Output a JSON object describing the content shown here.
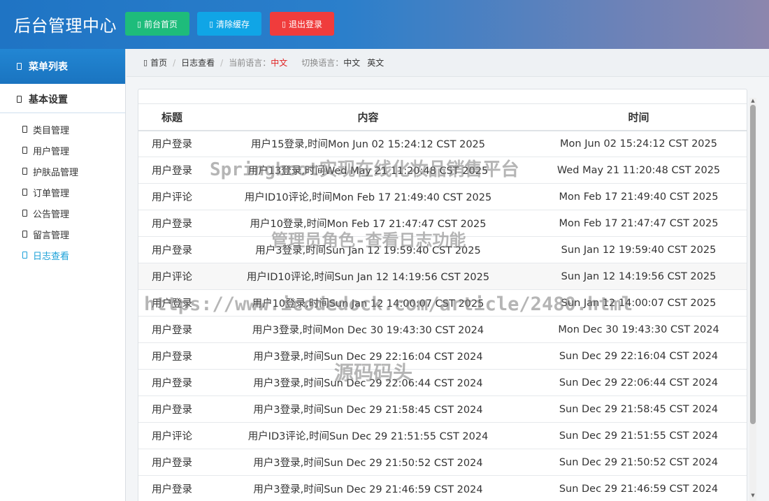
{
  "header": {
    "title": "后台管理中心",
    "buttons": [
      {
        "label": "前台首页",
        "color": "#1ebc7b"
      },
      {
        "label": "清除缓存",
        "color": "#10a5e6"
      },
      {
        "label": "退出登录",
        "color": "#f03c3c"
      }
    ]
  },
  "sidebar": {
    "menu_title": "菜单列表",
    "group_title": "基本设置",
    "items": [
      {
        "label": "类目管理"
      },
      {
        "label": "用户管理"
      },
      {
        "label": "护肤品管理"
      },
      {
        "label": "订单管理"
      },
      {
        "label": "公告管理"
      },
      {
        "label": "留言管理"
      },
      {
        "label": "日志查看",
        "active": true
      }
    ]
  },
  "breadcrumb": {
    "home": "首页",
    "current": "日志查看",
    "current_lang_label": "当前语言：",
    "current_lang": "中文",
    "switch_label": "切换语言：",
    "lang_zh": "中文",
    "lang_en": "英文"
  },
  "table": {
    "columns": [
      "标题",
      "内容",
      "时间"
    ],
    "rows": [
      [
        "用户登录",
        "用户15登录,时间Mon Jun 02 15:24:12 CST 2025",
        "Mon Jun 02 15:24:12 CST 2025"
      ],
      [
        "用户登录",
        "用户13登录,时间Wed May 21 11:20:48 CST 2025",
        "Wed May 21 11:20:48 CST 2025"
      ],
      [
        "用户评论",
        "用户ID10评论,时间Mon Feb 17 21:49:40 CST 2025",
        "Mon Feb 17 21:49:40 CST 2025"
      ],
      [
        "用户登录",
        "用户10登录,时间Mon Feb 17 21:47:47 CST 2025",
        "Mon Feb 17 21:47:47 CST 2025"
      ],
      [
        "用户登录",
        "用户3登录,时间Sun Jan 12 19:59:40 CST 2025",
        "Sun Jan 12 19:59:40 CST 2025"
      ],
      [
        "用户评论",
        "用户ID10评论,时间Sun Jan 12 14:19:56 CST 2025",
        "Sun Jan 12 14:19:56 CST 2025"
      ],
      [
        "用户登录",
        "用户10登录,时间Sun Jan 12 14:00:07 CST 2025",
        "Sun Jan 12 14:00:07 CST 2025"
      ],
      [
        "用户登录",
        "用户3登录,时间Mon Dec 30 19:43:30 CST 2024",
        "Mon Dec 30 19:43:30 CST 2024"
      ],
      [
        "用户登录",
        "用户3登录,时间Sun Dec 29 22:16:04 CST 2024",
        "Sun Dec 29 22:16:04 CST 2024"
      ],
      [
        "用户登录",
        "用户3登录,时间Sun Dec 29 22:06:44 CST 2024",
        "Sun Dec 29 22:06:44 CST 2024"
      ],
      [
        "用户登录",
        "用户3登录,时间Sun Dec 29 21:58:45 CST 2024",
        "Sun Dec 29 21:58:45 CST 2024"
      ],
      [
        "用户评论",
        "用户ID3评论,时间Sun Dec 29 21:51:55 CST 2024",
        "Sun Dec 29 21:51:55 CST 2024"
      ],
      [
        "用户登录",
        "用户3登录,时间Sun Dec 29 21:50:52 CST 2024",
        "Sun Dec 29 21:50:52 CST 2024"
      ],
      [
        "用户登录",
        "用户3登录,时间Sun Dec 29 21:46:59 CST 2024",
        "Sun Dec 29 21:46:59 CST 2024"
      ]
    ]
  },
  "watermarks": [
    "Springboot实现在线化妆品销售平台",
    "管理员角色-查看日志功能",
    "https://www.icodedock.com/article/2480.html",
    "源码码头"
  ]
}
